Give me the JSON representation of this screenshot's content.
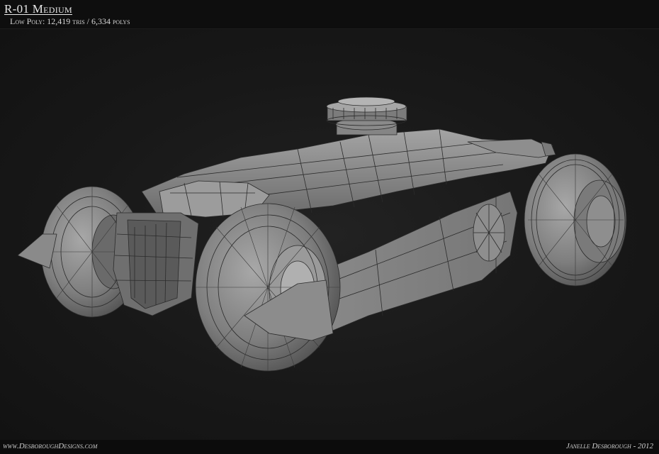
{
  "header": {
    "title": "R-01 Medium",
    "subtitle": "Low Poly: 12,419 tris / 6,334 polys"
  },
  "footer": {
    "website": "www.DesboroughDesigns.com",
    "credit": "Janelle Desborough - 2012"
  },
  "colors": {
    "background": "#141414",
    "mesh_fill": "#8a8a8a",
    "wire": "#2a2a2a"
  }
}
